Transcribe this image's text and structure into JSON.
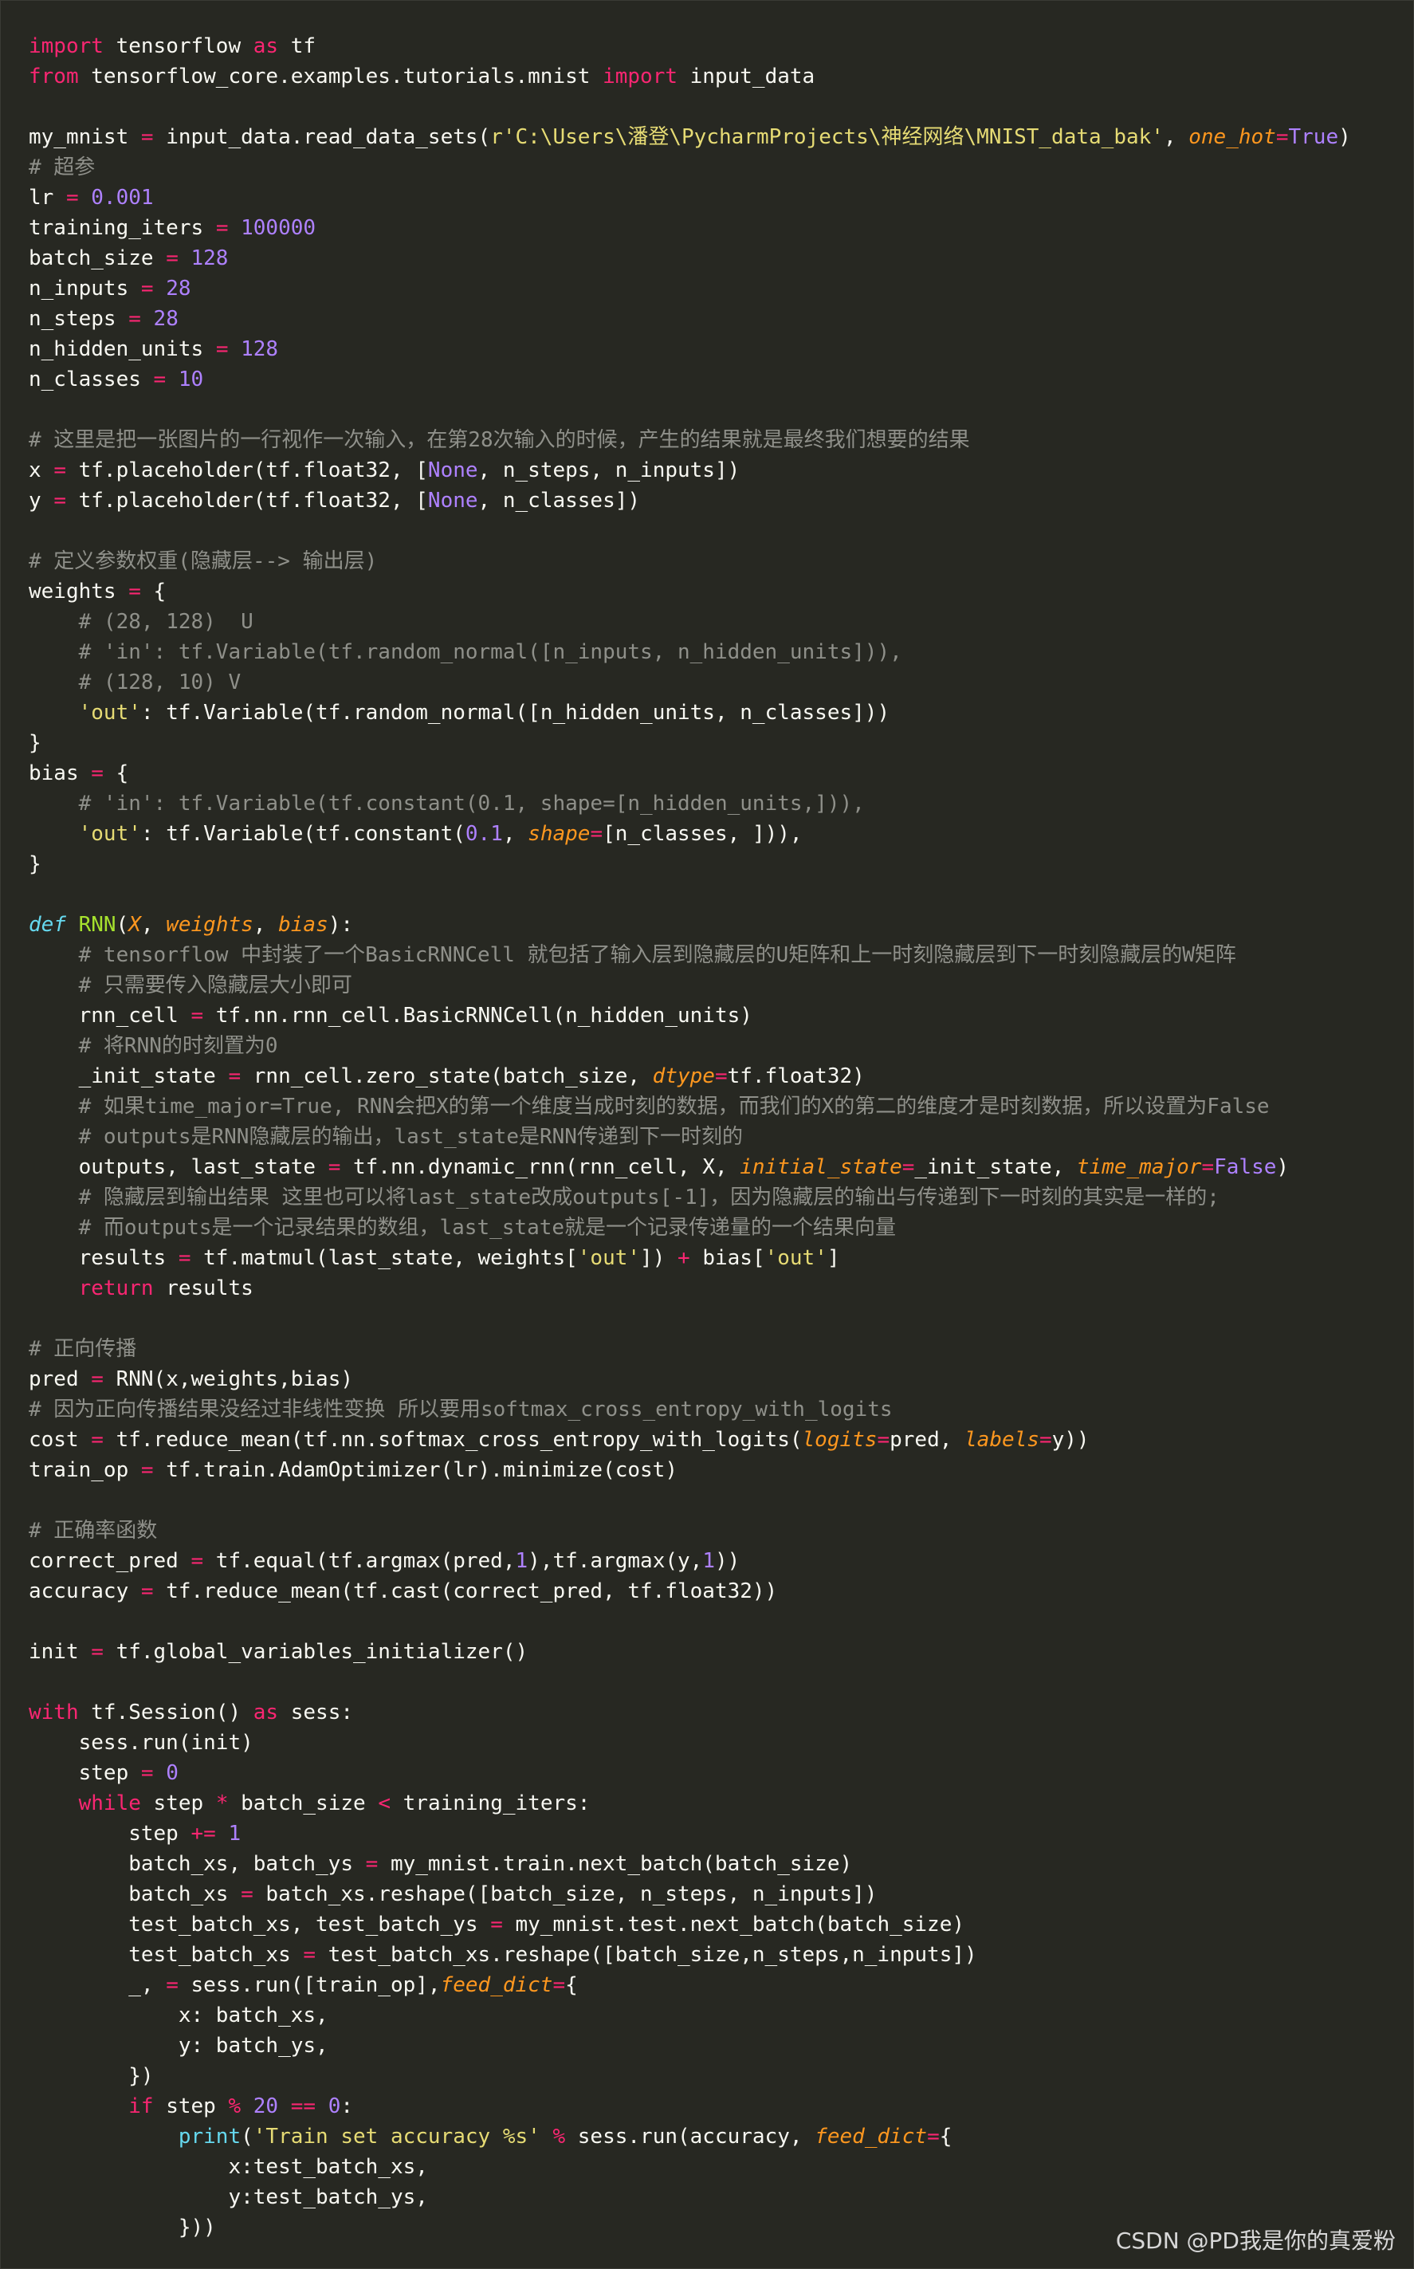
{
  "colors": {
    "background": "#272822",
    "keyword": "#f92672",
    "function": "#a6e22e",
    "number": "#ae81ff",
    "string": "#e6db74",
    "comment": "#8f908a",
    "parameter": "#fd971f",
    "builtin": "#66d9ef",
    "text": "#f8f8f2"
  },
  "code": {
    "language": "python",
    "lines": [
      [
        [
          "kw",
          "import"
        ],
        [
          "plain",
          " tensorflow "
        ],
        [
          "kw",
          "as"
        ],
        [
          "plain",
          " tf"
        ]
      ],
      [
        [
          "kw",
          "from"
        ],
        [
          "plain",
          " tensorflow_core.examples.tutorials.mnist "
        ],
        [
          "kw",
          "import"
        ],
        [
          "plain",
          " input_data"
        ]
      ],
      [],
      [
        [
          "plain",
          "my_mnist "
        ],
        [
          "op",
          "="
        ],
        [
          "plain",
          " input_data.read_data_sets("
        ],
        [
          "str",
          "r'C:\\Users\\潘登\\PycharmProjects\\神经网络\\MNIST_data_bak'"
        ],
        [
          "plain",
          ", "
        ],
        [
          "param",
          "one_hot"
        ],
        [
          "op",
          "="
        ],
        [
          "const",
          "True"
        ],
        [
          "plain",
          ")"
        ]
      ],
      [
        [
          "cm",
          "# 超参"
        ]
      ],
      [
        [
          "plain",
          "lr "
        ],
        [
          "op",
          "="
        ],
        [
          "plain",
          " "
        ],
        [
          "num",
          "0.001"
        ]
      ],
      [
        [
          "plain",
          "training_iters "
        ],
        [
          "op",
          "="
        ],
        [
          "plain",
          " "
        ],
        [
          "num",
          "100000"
        ]
      ],
      [
        [
          "plain",
          "batch_size "
        ],
        [
          "op",
          "="
        ],
        [
          "plain",
          " "
        ],
        [
          "num",
          "128"
        ]
      ],
      [
        [
          "plain",
          "n_inputs "
        ],
        [
          "op",
          "="
        ],
        [
          "plain",
          " "
        ],
        [
          "num",
          "28"
        ]
      ],
      [
        [
          "plain",
          "n_steps "
        ],
        [
          "op",
          "="
        ],
        [
          "plain",
          " "
        ],
        [
          "num",
          "28"
        ]
      ],
      [
        [
          "plain",
          "n_hidden_units "
        ],
        [
          "op",
          "="
        ],
        [
          "plain",
          " "
        ],
        [
          "num",
          "128"
        ]
      ],
      [
        [
          "plain",
          "n_classes "
        ],
        [
          "op",
          "="
        ],
        [
          "plain",
          " "
        ],
        [
          "num",
          "10"
        ]
      ],
      [],
      [
        [
          "cm",
          "# 这里是把一张图片的一行视作一次输入，在第28次输入的时候，产生的结果就是最终我们想要的结果"
        ]
      ],
      [
        [
          "plain",
          "x "
        ],
        [
          "op",
          "="
        ],
        [
          "plain",
          " tf.placeholder(tf.float32, ["
        ],
        [
          "const",
          "None"
        ],
        [
          "plain",
          ", n_steps, n_inputs])"
        ]
      ],
      [
        [
          "plain",
          "y "
        ],
        [
          "op",
          "="
        ],
        [
          "plain",
          " tf.placeholder(tf.float32, ["
        ],
        [
          "const",
          "None"
        ],
        [
          "plain",
          ", n_classes])"
        ]
      ],
      [],
      [
        [
          "cm",
          "# 定义参数权重(隐藏层--> 输出层)"
        ]
      ],
      [
        [
          "plain",
          "weights "
        ],
        [
          "op",
          "="
        ],
        [
          "plain",
          " {"
        ]
      ],
      [
        [
          "plain",
          "    "
        ],
        [
          "cm",
          "# (28, 128)  U"
        ]
      ],
      [
        [
          "plain",
          "    "
        ],
        [
          "cm",
          "# 'in': tf.Variable(tf.random_normal([n_inputs, n_hidden_units])),"
        ]
      ],
      [
        [
          "plain",
          "    "
        ],
        [
          "cm",
          "# (128, 10) V"
        ]
      ],
      [
        [
          "plain",
          "    "
        ],
        [
          "str",
          "'out'"
        ],
        [
          "plain",
          ": tf.Variable(tf.random_normal([n_hidden_units, n_classes]))"
        ]
      ],
      [
        [
          "plain",
          "}"
        ]
      ],
      [
        [
          "plain",
          "bias "
        ],
        [
          "op",
          "="
        ],
        [
          "plain",
          " {"
        ]
      ],
      [
        [
          "plain",
          "    "
        ],
        [
          "cm",
          "# 'in': tf.Variable(tf.constant(0.1, shape=[n_hidden_units,])),"
        ]
      ],
      [
        [
          "plain",
          "    "
        ],
        [
          "str",
          "'out'"
        ],
        [
          "plain",
          ": tf.Variable(tf.constant("
        ],
        [
          "num",
          "0.1"
        ],
        [
          "plain",
          ", "
        ],
        [
          "param",
          "shape"
        ],
        [
          "op",
          "="
        ],
        [
          "plain",
          "[n_classes, ])),"
        ]
      ],
      [
        [
          "plain",
          "}"
        ]
      ],
      [],
      [
        [
          "def",
          "def"
        ],
        [
          "plain",
          " "
        ],
        [
          "fn",
          "RNN"
        ],
        [
          "plain",
          "("
        ],
        [
          "param",
          "X"
        ],
        [
          "plain",
          ", "
        ],
        [
          "param",
          "weights"
        ],
        [
          "plain",
          ", "
        ],
        [
          "param",
          "bias"
        ],
        [
          "plain",
          "):"
        ]
      ],
      [
        [
          "plain",
          "    "
        ],
        [
          "cm",
          "# tensorflow 中封装了一个BasicRNNCell 就包括了输入层到隐藏层的U矩阵和上一时刻隐藏层到下一时刻隐藏层的W矩阵"
        ]
      ],
      [
        [
          "plain",
          "    "
        ],
        [
          "cm",
          "# 只需要传入隐藏层大小即可"
        ]
      ],
      [
        [
          "plain",
          "    rnn_cell "
        ],
        [
          "op",
          "="
        ],
        [
          "plain",
          " tf.nn.rnn_cell.BasicRNNCell(n_hidden_units)"
        ]
      ],
      [
        [
          "plain",
          "    "
        ],
        [
          "cm",
          "# 将RNN的时刻置为0"
        ]
      ],
      [
        [
          "plain",
          "    _init_state "
        ],
        [
          "op",
          "="
        ],
        [
          "plain",
          " rnn_cell.zero_state(batch_size, "
        ],
        [
          "param",
          "dtype"
        ],
        [
          "op",
          "="
        ],
        [
          "plain",
          "tf.float32)"
        ]
      ],
      [
        [
          "plain",
          "    "
        ],
        [
          "cm",
          "# 如果time_major=True, RNN会把X的第一个维度当成时刻的数据，而我们的X的第二的维度才是时刻数据，所以设置为False"
        ]
      ],
      [
        [
          "plain",
          "    "
        ],
        [
          "cm",
          "# outputs是RNN隐藏层的输出，last_state是RNN传递到下一时刻的"
        ]
      ],
      [
        [
          "plain",
          "    outputs, last_state "
        ],
        [
          "op",
          "="
        ],
        [
          "plain",
          " tf.nn.dynamic_rnn(rnn_cell, X, "
        ],
        [
          "param",
          "initial_state"
        ],
        [
          "op",
          "="
        ],
        [
          "plain",
          "_init_state, "
        ],
        [
          "param",
          "time_major"
        ],
        [
          "op",
          "="
        ],
        [
          "const",
          "False"
        ],
        [
          "plain",
          ")"
        ]
      ],
      [
        [
          "plain",
          "    "
        ],
        [
          "cm",
          "# 隐藏层到输出结果 这里也可以将last_state改成outputs[-1]，因为隐藏层的输出与传递到下一时刻的其实是一样的;"
        ]
      ],
      [
        [
          "plain",
          "    "
        ],
        [
          "cm",
          "# 而outputs是一个记录结果的数组，last_state就是一个记录传递量的一个结果向量"
        ]
      ],
      [
        [
          "plain",
          "    results "
        ],
        [
          "op",
          "="
        ],
        [
          "plain",
          " tf.matmul(last_state, weights["
        ],
        [
          "str",
          "'out'"
        ],
        [
          "plain",
          "]) "
        ],
        [
          "op",
          "+"
        ],
        [
          "plain",
          " bias["
        ],
        [
          "str",
          "'out'"
        ],
        [
          "plain",
          "]"
        ]
      ],
      [
        [
          "plain",
          "    "
        ],
        [
          "kw",
          "return"
        ],
        [
          "plain",
          " results"
        ]
      ],
      [],
      [
        [
          "cm",
          "# 正向传播"
        ]
      ],
      [
        [
          "plain",
          "pred "
        ],
        [
          "op",
          "="
        ],
        [
          "plain",
          " RNN(x,weights,bias)"
        ]
      ],
      [
        [
          "cm",
          "# 因为正向传播结果没经过非线性变换 所以要用softmax_cross_entropy_with_logits"
        ]
      ],
      [
        [
          "plain",
          "cost "
        ],
        [
          "op",
          "="
        ],
        [
          "plain",
          " tf.reduce_mean(tf.nn.softmax_cross_entropy_with_logits("
        ],
        [
          "param",
          "logits"
        ],
        [
          "op",
          "="
        ],
        [
          "plain",
          "pred, "
        ],
        [
          "param",
          "labels"
        ],
        [
          "op",
          "="
        ],
        [
          "plain",
          "y))"
        ]
      ],
      [
        [
          "plain",
          "train_op "
        ],
        [
          "op",
          "="
        ],
        [
          "plain",
          " tf.train.AdamOptimizer(lr).minimize(cost)"
        ]
      ],
      [],
      [
        [
          "cm",
          "# 正确率函数"
        ]
      ],
      [
        [
          "plain",
          "correct_pred "
        ],
        [
          "op",
          "="
        ],
        [
          "plain",
          " tf.equal(tf.argmax(pred,"
        ],
        [
          "num",
          "1"
        ],
        [
          "plain",
          "),tf.argmax(y,"
        ],
        [
          "num",
          "1"
        ],
        [
          "plain",
          "))"
        ]
      ],
      [
        [
          "plain",
          "accuracy "
        ],
        [
          "op",
          "="
        ],
        [
          "plain",
          " tf.reduce_mean(tf.cast(correct_pred, tf.float32))"
        ]
      ],
      [],
      [
        [
          "plain",
          "init "
        ],
        [
          "op",
          "="
        ],
        [
          "plain",
          " tf.global_variables_initializer()"
        ]
      ],
      [],
      [
        [
          "kw",
          "with"
        ],
        [
          "plain",
          " tf.Session() "
        ],
        [
          "kw",
          "as"
        ],
        [
          "plain",
          " sess:"
        ]
      ],
      [
        [
          "plain",
          "    sess.run(init)"
        ]
      ],
      [
        [
          "plain",
          "    step "
        ],
        [
          "op",
          "="
        ],
        [
          "plain",
          " "
        ],
        [
          "num",
          "0"
        ]
      ],
      [
        [
          "plain",
          "    "
        ],
        [
          "kw",
          "while"
        ],
        [
          "plain",
          " step "
        ],
        [
          "op",
          "*"
        ],
        [
          "plain",
          " batch_size "
        ],
        [
          "op",
          "<"
        ],
        [
          "plain",
          " training_iters:"
        ]
      ],
      [
        [
          "plain",
          "        step "
        ],
        [
          "op",
          "+="
        ],
        [
          "plain",
          " "
        ],
        [
          "num",
          "1"
        ]
      ],
      [
        [
          "plain",
          "        batch_xs, batch_ys "
        ],
        [
          "op",
          "="
        ],
        [
          "plain",
          " my_mnist.train.next_batch(batch_size)"
        ]
      ],
      [
        [
          "plain",
          "        batch_xs "
        ],
        [
          "op",
          "="
        ],
        [
          "plain",
          " batch_xs.reshape([batch_size, n_steps, n_inputs])"
        ]
      ],
      [
        [
          "plain",
          "        test_batch_xs, test_batch_ys "
        ],
        [
          "op",
          "="
        ],
        [
          "plain",
          " my_mnist.test.next_batch(batch_size)"
        ]
      ],
      [
        [
          "plain",
          "        test_batch_xs "
        ],
        [
          "op",
          "="
        ],
        [
          "plain",
          " test_batch_xs.reshape([batch_size,n_steps,n_inputs])"
        ]
      ],
      [
        [
          "plain",
          "        _, "
        ],
        [
          "op",
          "="
        ],
        [
          "plain",
          " sess.run([train_op],"
        ],
        [
          "param",
          "feed_dict"
        ],
        [
          "op",
          "="
        ],
        [
          "plain",
          "{"
        ]
      ],
      [
        [
          "plain",
          "            x: batch_xs,"
        ]
      ],
      [
        [
          "plain",
          "            y: batch_ys,"
        ]
      ],
      [
        [
          "plain",
          "        })"
        ]
      ],
      [
        [
          "plain",
          "        "
        ],
        [
          "kw",
          "if"
        ],
        [
          "plain",
          " step "
        ],
        [
          "op",
          "%"
        ],
        [
          "plain",
          " "
        ],
        [
          "num",
          "20"
        ],
        [
          "plain",
          " "
        ],
        [
          "op",
          "=="
        ],
        [
          "plain",
          " "
        ],
        [
          "num",
          "0"
        ],
        [
          "plain",
          ":"
        ]
      ],
      [
        [
          "plain",
          "            "
        ],
        [
          "builtin",
          "print"
        ],
        [
          "plain",
          "("
        ],
        [
          "str",
          "'Train set accuracy %s'"
        ],
        [
          "plain",
          " "
        ],
        [
          "op",
          "%"
        ],
        [
          "plain",
          " sess.run(accuracy, "
        ],
        [
          "param",
          "feed_dict"
        ],
        [
          "op",
          "="
        ],
        [
          "plain",
          "{"
        ]
      ],
      [
        [
          "plain",
          "                x:test_batch_xs,"
        ]
      ],
      [
        [
          "plain",
          "                y:test_batch_ys,"
        ]
      ],
      [
        [
          "plain",
          "            }))"
        ]
      ]
    ]
  },
  "watermark": {
    "text": "CSDN @PD我是你的真爱粉"
  }
}
